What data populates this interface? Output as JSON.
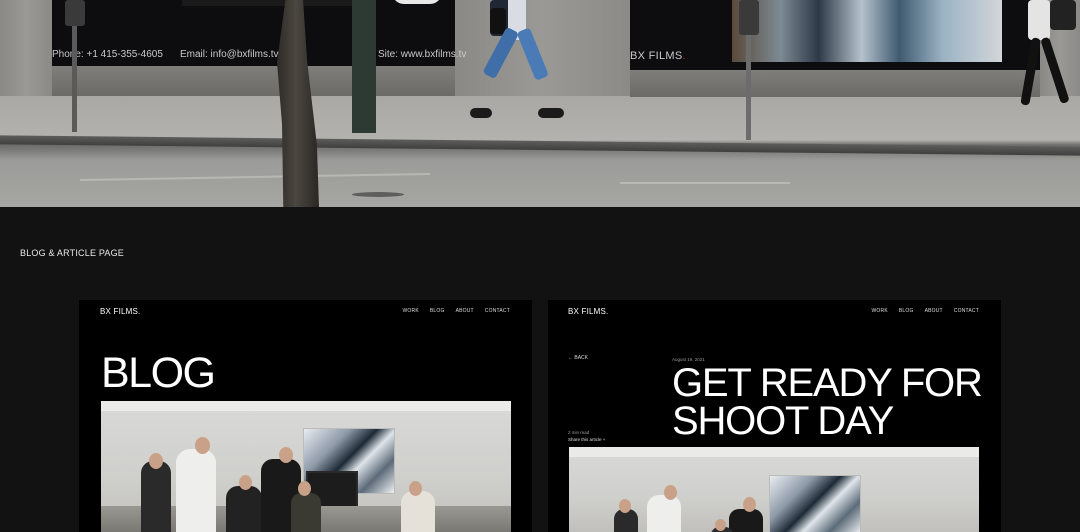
{
  "hero": {
    "phone": "Phone: +1 415-355-4605",
    "email": "Email: info@bxfilms.tv",
    "site": "Site: www.bxfilms.tv",
    "window_brand": "BX FILMS",
    "window_brand_dot": "."
  },
  "section_label": "BLOG & ARTICLE PAGE",
  "panel_left": {
    "brand": "BX FILMS.",
    "nav": [
      "WORK",
      "BLOG",
      "ABOUT",
      "CONTACT"
    ],
    "title": "BLOG"
  },
  "panel_right": {
    "brand": "BX FILMS.",
    "nav": [
      "WORK",
      "BLOG",
      "ABOUT",
      "CONTACT"
    ],
    "back": "← BACK",
    "date": "August 19, 2021",
    "title": "GET READY FOR SHOOT DAY",
    "read_time": "2 min read",
    "share": "Share this article +"
  },
  "colors": {
    "page_bg": "#121212",
    "panel_bg": "#000000",
    "brand_dot": "#e0262f"
  }
}
